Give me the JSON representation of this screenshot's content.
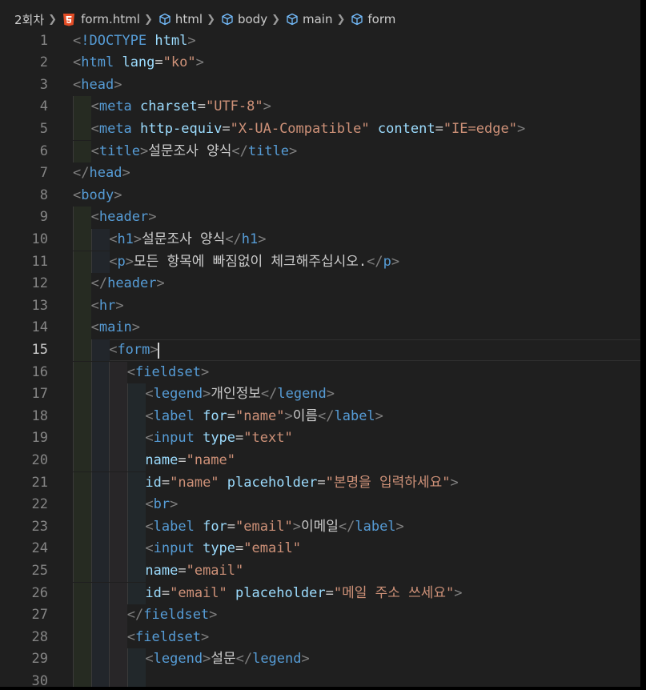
{
  "breadcrumb": {
    "folder": "2회차",
    "file": "form.html",
    "path": [
      "html",
      "body",
      "main",
      "form"
    ]
  },
  "colors": {
    "background": "#1f1f1f",
    "tag": "#569cd6",
    "attribute": "#9cdcfe",
    "string": "#ce9178",
    "punctuation": "#808080",
    "text": "#cccccc",
    "html5_icon": "#e44d26"
  },
  "icons": [
    "html5-file-icon",
    "cube-symbol-icon",
    "chevron-right-icon"
  ],
  "editor": {
    "active_line": 15,
    "lines": [
      {
        "n": 1,
        "indent": 0,
        "tokens": [
          [
            "t",
            "<"
          ],
          [
            "tag",
            "!DOCTYPE"
          ],
          [
            "txt",
            " "
          ],
          [
            "attr",
            "html"
          ],
          [
            "t",
            ">"
          ]
        ]
      },
      {
        "n": 2,
        "indent": 0,
        "tokens": [
          [
            "t",
            "<"
          ],
          [
            "tag",
            "html"
          ],
          [
            "txt",
            " "
          ],
          [
            "attr",
            "lang"
          ],
          [
            "txt",
            "="
          ],
          [
            "str",
            "\"ko\""
          ],
          [
            "t",
            ">"
          ]
        ]
      },
      {
        "n": 3,
        "indent": 0,
        "tokens": [
          [
            "t",
            "<"
          ],
          [
            "tag",
            "head"
          ],
          [
            "t",
            ">"
          ]
        ]
      },
      {
        "n": 4,
        "indent": 1,
        "tokens": [
          [
            "t",
            "<"
          ],
          [
            "tag",
            "meta"
          ],
          [
            "txt",
            " "
          ],
          [
            "attr",
            "charset"
          ],
          [
            "txt",
            "="
          ],
          [
            "str",
            "\"UTF-8\""
          ],
          [
            "t",
            ">"
          ]
        ]
      },
      {
        "n": 5,
        "indent": 1,
        "tokens": [
          [
            "t",
            "<"
          ],
          [
            "tag",
            "meta"
          ],
          [
            "txt",
            " "
          ],
          [
            "attr",
            "http-equiv"
          ],
          [
            "txt",
            "="
          ],
          [
            "str",
            "\"X-UA-Compatible\""
          ],
          [
            "txt",
            " "
          ],
          [
            "attr",
            "content"
          ],
          [
            "txt",
            "="
          ],
          [
            "str",
            "\"IE=edge\""
          ],
          [
            "t",
            ">"
          ]
        ]
      },
      {
        "n": 6,
        "indent": 1,
        "tokens": [
          [
            "t",
            "<"
          ],
          [
            "tag",
            "title"
          ],
          [
            "t",
            ">"
          ],
          [
            "txt",
            "설문조사 양식"
          ],
          [
            "t",
            "</"
          ],
          [
            "tag",
            "title"
          ],
          [
            "t",
            ">"
          ]
        ]
      },
      {
        "n": 7,
        "indent": 0,
        "tokens": [
          [
            "t",
            "</"
          ],
          [
            "tag",
            "head"
          ],
          [
            "t",
            ">"
          ]
        ]
      },
      {
        "n": 8,
        "indent": 0,
        "tokens": [
          [
            "t",
            "<"
          ],
          [
            "tag",
            "body"
          ],
          [
            "t",
            ">"
          ]
        ]
      },
      {
        "n": 9,
        "indent": 1,
        "tokens": [
          [
            "t",
            "<"
          ],
          [
            "tag",
            "header"
          ],
          [
            "t",
            ">"
          ]
        ]
      },
      {
        "n": 10,
        "indent": 2,
        "tokens": [
          [
            "t",
            "<"
          ],
          [
            "tag",
            "h1"
          ],
          [
            "t",
            ">"
          ],
          [
            "txt",
            "설문조사 양식"
          ],
          [
            "t",
            "</"
          ],
          [
            "tag",
            "h1"
          ],
          [
            "t",
            ">"
          ]
        ]
      },
      {
        "n": 11,
        "indent": 2,
        "tokens": [
          [
            "t",
            "<"
          ],
          [
            "tag",
            "p"
          ],
          [
            "t",
            ">"
          ],
          [
            "txt",
            "모든 항목에 빠짐없이 체크해주십시오."
          ],
          [
            "t",
            "</"
          ],
          [
            "tag",
            "p"
          ],
          [
            "t",
            ">"
          ]
        ]
      },
      {
        "n": 12,
        "indent": 1,
        "tokens": [
          [
            "t",
            "</"
          ],
          [
            "tag",
            "header"
          ],
          [
            "t",
            ">"
          ]
        ]
      },
      {
        "n": 13,
        "indent": 1,
        "tokens": [
          [
            "t",
            "<"
          ],
          [
            "tag",
            "hr"
          ],
          [
            "t",
            ">"
          ]
        ]
      },
      {
        "n": 14,
        "indent": 1,
        "tokens": [
          [
            "t",
            "<"
          ],
          [
            "tag",
            "main"
          ],
          [
            "t",
            ">"
          ]
        ]
      },
      {
        "n": 15,
        "indent": 2,
        "tokens": [
          [
            "t",
            "<"
          ],
          [
            "tag",
            "form"
          ],
          [
            "t",
            ">"
          ]
        ]
      },
      {
        "n": 16,
        "indent": 3,
        "tokens": [
          [
            "t",
            "<"
          ],
          [
            "tag",
            "fieldset"
          ],
          [
            "t",
            ">"
          ]
        ]
      },
      {
        "n": 17,
        "indent": 4,
        "tokens": [
          [
            "t",
            "<"
          ],
          [
            "tag",
            "legend"
          ],
          [
            "t",
            ">"
          ],
          [
            "txt",
            "개인정보"
          ],
          [
            "t",
            "</"
          ],
          [
            "tag",
            "legend"
          ],
          [
            "t",
            ">"
          ]
        ]
      },
      {
        "n": 18,
        "indent": 4,
        "tokens": [
          [
            "t",
            "<"
          ],
          [
            "tag",
            "label"
          ],
          [
            "txt",
            " "
          ],
          [
            "attr",
            "for"
          ],
          [
            "txt",
            "="
          ],
          [
            "str",
            "\"name\""
          ],
          [
            "t",
            ">"
          ],
          [
            "txt",
            "이름"
          ],
          [
            "t",
            "</"
          ],
          [
            "tag",
            "label"
          ],
          [
            "t",
            ">"
          ]
        ]
      },
      {
        "n": 19,
        "indent": 4,
        "tokens": [
          [
            "t",
            "<"
          ],
          [
            "tag",
            "input"
          ],
          [
            "txt",
            " "
          ],
          [
            "attr",
            "type"
          ],
          [
            "txt",
            "="
          ],
          [
            "str",
            "\"text\""
          ]
        ]
      },
      {
        "n": 20,
        "indent": 4,
        "tokens": [
          [
            "attr",
            "name"
          ],
          [
            "txt",
            "="
          ],
          [
            "str",
            "\"name\""
          ]
        ]
      },
      {
        "n": 21,
        "indent": 4,
        "tokens": [
          [
            "attr",
            "id"
          ],
          [
            "txt",
            "="
          ],
          [
            "str",
            "\"name\""
          ],
          [
            "txt",
            " "
          ],
          [
            "attr",
            "placeholder"
          ],
          [
            "txt",
            "="
          ],
          [
            "str",
            "\"본명을 입력하세요\""
          ],
          [
            "t",
            ">"
          ]
        ]
      },
      {
        "n": 22,
        "indent": 4,
        "tokens": [
          [
            "t",
            "<"
          ],
          [
            "tag",
            "br"
          ],
          [
            "t",
            ">"
          ]
        ]
      },
      {
        "n": 23,
        "indent": 4,
        "tokens": [
          [
            "t",
            "<"
          ],
          [
            "tag",
            "label"
          ],
          [
            "txt",
            " "
          ],
          [
            "attr",
            "for"
          ],
          [
            "txt",
            "="
          ],
          [
            "str",
            "\"email\""
          ],
          [
            "t",
            ">"
          ],
          [
            "txt",
            "이메일"
          ],
          [
            "t",
            "</"
          ],
          [
            "tag",
            "label"
          ],
          [
            "t",
            ">"
          ]
        ]
      },
      {
        "n": 24,
        "indent": 4,
        "tokens": [
          [
            "t",
            "<"
          ],
          [
            "tag",
            "input"
          ],
          [
            "txt",
            " "
          ],
          [
            "attr",
            "type"
          ],
          [
            "txt",
            "="
          ],
          [
            "str",
            "\"email\""
          ]
        ]
      },
      {
        "n": 25,
        "indent": 4,
        "tokens": [
          [
            "attr",
            "name"
          ],
          [
            "txt",
            "="
          ],
          [
            "str",
            "\"email\""
          ]
        ]
      },
      {
        "n": 26,
        "indent": 4,
        "tokens": [
          [
            "attr",
            "id"
          ],
          [
            "txt",
            "="
          ],
          [
            "str",
            "\"email\""
          ],
          [
            "txt",
            " "
          ],
          [
            "attr",
            "placeholder"
          ],
          [
            "txt",
            "="
          ],
          [
            "str",
            "\"메일 주소 쓰세요\""
          ],
          [
            "t",
            ">"
          ]
        ]
      },
      {
        "n": 27,
        "indent": 3,
        "tokens": [
          [
            "t",
            "</"
          ],
          [
            "tag",
            "fieldset"
          ],
          [
            "t",
            ">"
          ]
        ]
      },
      {
        "n": 28,
        "indent": 3,
        "tokens": [
          [
            "t",
            "<"
          ],
          [
            "tag",
            "fieldset"
          ],
          [
            "t",
            ">"
          ]
        ]
      },
      {
        "n": 29,
        "indent": 4,
        "tokens": [
          [
            "t",
            "<"
          ],
          [
            "tag",
            "legend"
          ],
          [
            "t",
            ">"
          ],
          [
            "txt",
            "설문"
          ],
          [
            "t",
            "</"
          ],
          [
            "tag",
            "legend"
          ],
          [
            "t",
            ">"
          ]
        ]
      },
      {
        "n": 30,
        "indent": 4,
        "tokens": []
      }
    ]
  }
}
